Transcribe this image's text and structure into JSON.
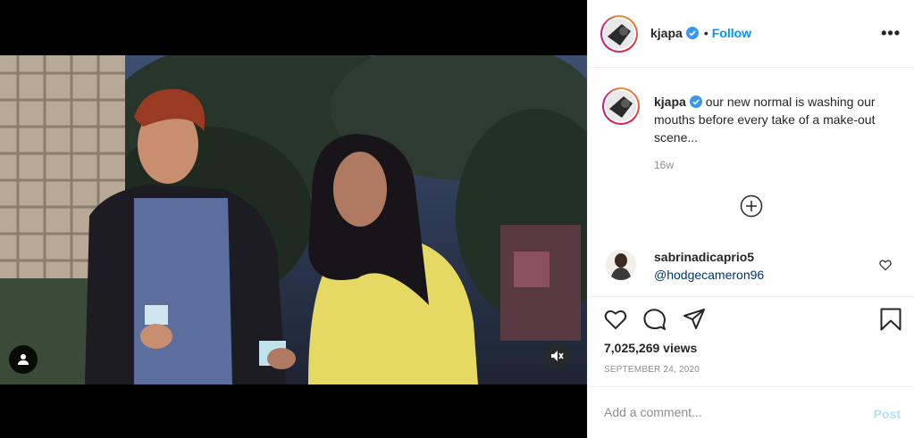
{
  "post": {
    "author": "kjapa",
    "follow_label": "Follow",
    "more_label": "•••",
    "caption": "our new normal is washing our mouths before every take of a make-out scene...",
    "time_ago": "16w",
    "views": "7,025,269 views",
    "date": "SEPTEMBER 24, 2020"
  },
  "comments": [
    {
      "username": "sabrinadicaprio5",
      "text": "@hodgecameron96"
    }
  ],
  "add_comment": {
    "placeholder": "Add a comment...",
    "post_label": "Post"
  },
  "icons": {
    "verified": "verified-badge-icon",
    "tag": "user-tag-icon",
    "mute": "muted-speaker-icon",
    "more": "more-options-icon",
    "load_more": "load-more-comments-icon",
    "comment_like": "heart-icon",
    "like": "heart-icon",
    "comment": "comment-bubble-icon",
    "share": "paper-plane-icon",
    "save": "bookmark-icon"
  },
  "colors": {
    "accent": "#0095f6",
    "post_disabled": "#b2dffc",
    "mention": "#00376b",
    "muted_text": "#8e8e8e"
  }
}
